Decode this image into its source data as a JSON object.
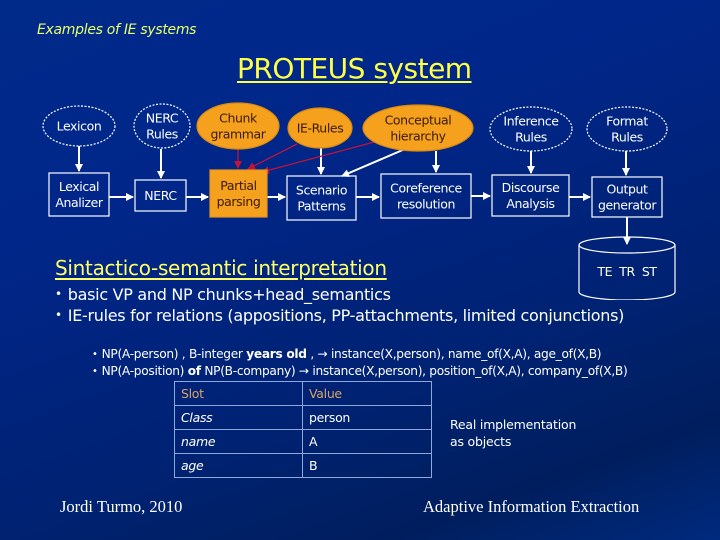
{
  "slide": {
    "subtitle": "Examples of IE systems",
    "title": "PROTEUS system",
    "colors": {
      "background": "#00268a",
      "heading_yellow": "#ffff44",
      "knowledge_orange": "#f5a11e",
      "red_arrow": "#c0143c",
      "line_white": "#ffffff"
    }
  },
  "diagram": {
    "knowledge_sources": [
      {
        "id": "lexicon",
        "label": [
          "Lexicon"
        ],
        "style": "dashed"
      },
      {
        "id": "nerc-rules",
        "label": [
          "NERC",
          "Rules"
        ],
        "style": "dashed"
      },
      {
        "id": "chunk-grammar",
        "label": [
          "Chunk",
          "grammar"
        ],
        "style": "orange"
      },
      {
        "id": "ie-rules",
        "label": [
          "IE-Rules"
        ],
        "style": "orange"
      },
      {
        "id": "conceptual-hierarchy",
        "label": [
          "Conceptual",
          "hierarchy"
        ],
        "style": "orange"
      },
      {
        "id": "inference-rules",
        "label": [
          "Inference",
          "Rules"
        ],
        "style": "dashed"
      },
      {
        "id": "format-rules",
        "label": [
          "Format",
          "Rules"
        ],
        "style": "dashed"
      }
    ],
    "modules": [
      {
        "id": "lexical-analizer",
        "label": [
          "Lexical",
          "Analizer"
        ],
        "style": "outline"
      },
      {
        "id": "nerc",
        "label": [
          "NERC"
        ],
        "style": "outline"
      },
      {
        "id": "partial-parsing",
        "label": [
          "Partial",
          "parsing"
        ],
        "style": "orange"
      },
      {
        "id": "scenario-patterns",
        "label": [
          "Scenario",
          "Patterns"
        ],
        "style": "outline"
      },
      {
        "id": "coreference-resolution",
        "label": [
          "Coreference",
          "resolution"
        ],
        "style": "outline"
      },
      {
        "id": "discourse-analysis",
        "label": [
          "Discourse",
          "Analysis"
        ],
        "style": "outline"
      },
      {
        "id": "output-generator",
        "label": [
          "Output",
          "generator"
        ],
        "style": "outline"
      }
    ],
    "output_store": {
      "label": "TE  TR  ST"
    }
  },
  "section": {
    "heading": "Sintactico-semantic interpretation",
    "bullets": [
      "basic VP and NP chunks+head_semantics",
      "IE-rules for relations (appositions,  PP-attachments, limited conjunctions)"
    ],
    "rules": [
      {
        "pre": "NP(A-person) , B-integer ",
        "bold": "years old",
        "post": " , → instance(X,person), name_of(X,A), age_of(X,B)"
      },
      {
        "pre": "NP(A-position) ",
        "bold": "of",
        "post": " NP(B-company) → instance(X,person), position_of(X,A), company_of(X,B)"
      }
    ]
  },
  "slot_table": {
    "headers": [
      "Slot",
      "Value"
    ],
    "rows": [
      [
        "Class",
        "person"
      ],
      [
        "name",
        "A"
      ],
      [
        "age",
        "B"
      ]
    ]
  },
  "note": {
    "line1": "Real implementation",
    "line2": "as objects"
  },
  "footer": {
    "author": "Jordi Turmo, 2010",
    "course": "Adaptive Information Extraction"
  }
}
